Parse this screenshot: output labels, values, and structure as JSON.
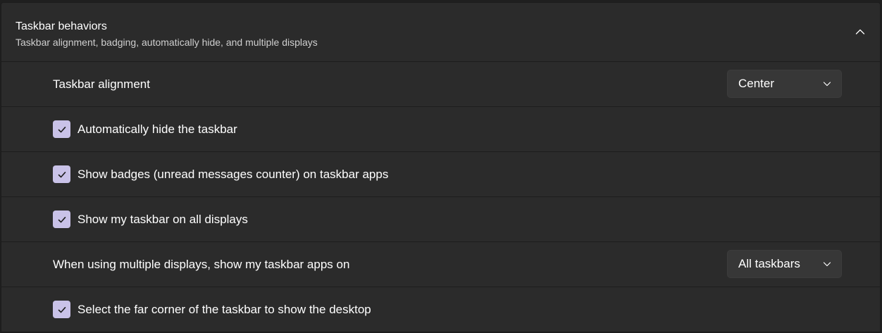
{
  "section": {
    "title": "Taskbar behaviors",
    "subtitle": "Taskbar alignment, badging, automatically hide, and multiple displays",
    "expanded": true
  },
  "settings": {
    "alignment": {
      "label": "Taskbar alignment",
      "value": "Center"
    },
    "auto_hide": {
      "label": "Automatically hide the taskbar",
      "checked": true
    },
    "badges": {
      "label": "Show badges (unread messages counter) on taskbar apps",
      "checked": true
    },
    "all_displays": {
      "label": "Show my taskbar on all displays",
      "checked": true
    },
    "multi_display_apps": {
      "label": "When using multiple displays, show my taskbar apps on",
      "value": "All taskbars"
    },
    "far_corner": {
      "label": "Select the far corner of the taskbar to show the desktop",
      "checked": true
    }
  },
  "colors": {
    "panel_background": "#2b2b2b",
    "checkbox_accent": "#c9c2e8",
    "dropdown_background": "#373737"
  },
  "icons": {
    "collapse": "chevron-up-icon",
    "dropdown": "chevron-down-icon",
    "check": "checkmark-icon"
  }
}
